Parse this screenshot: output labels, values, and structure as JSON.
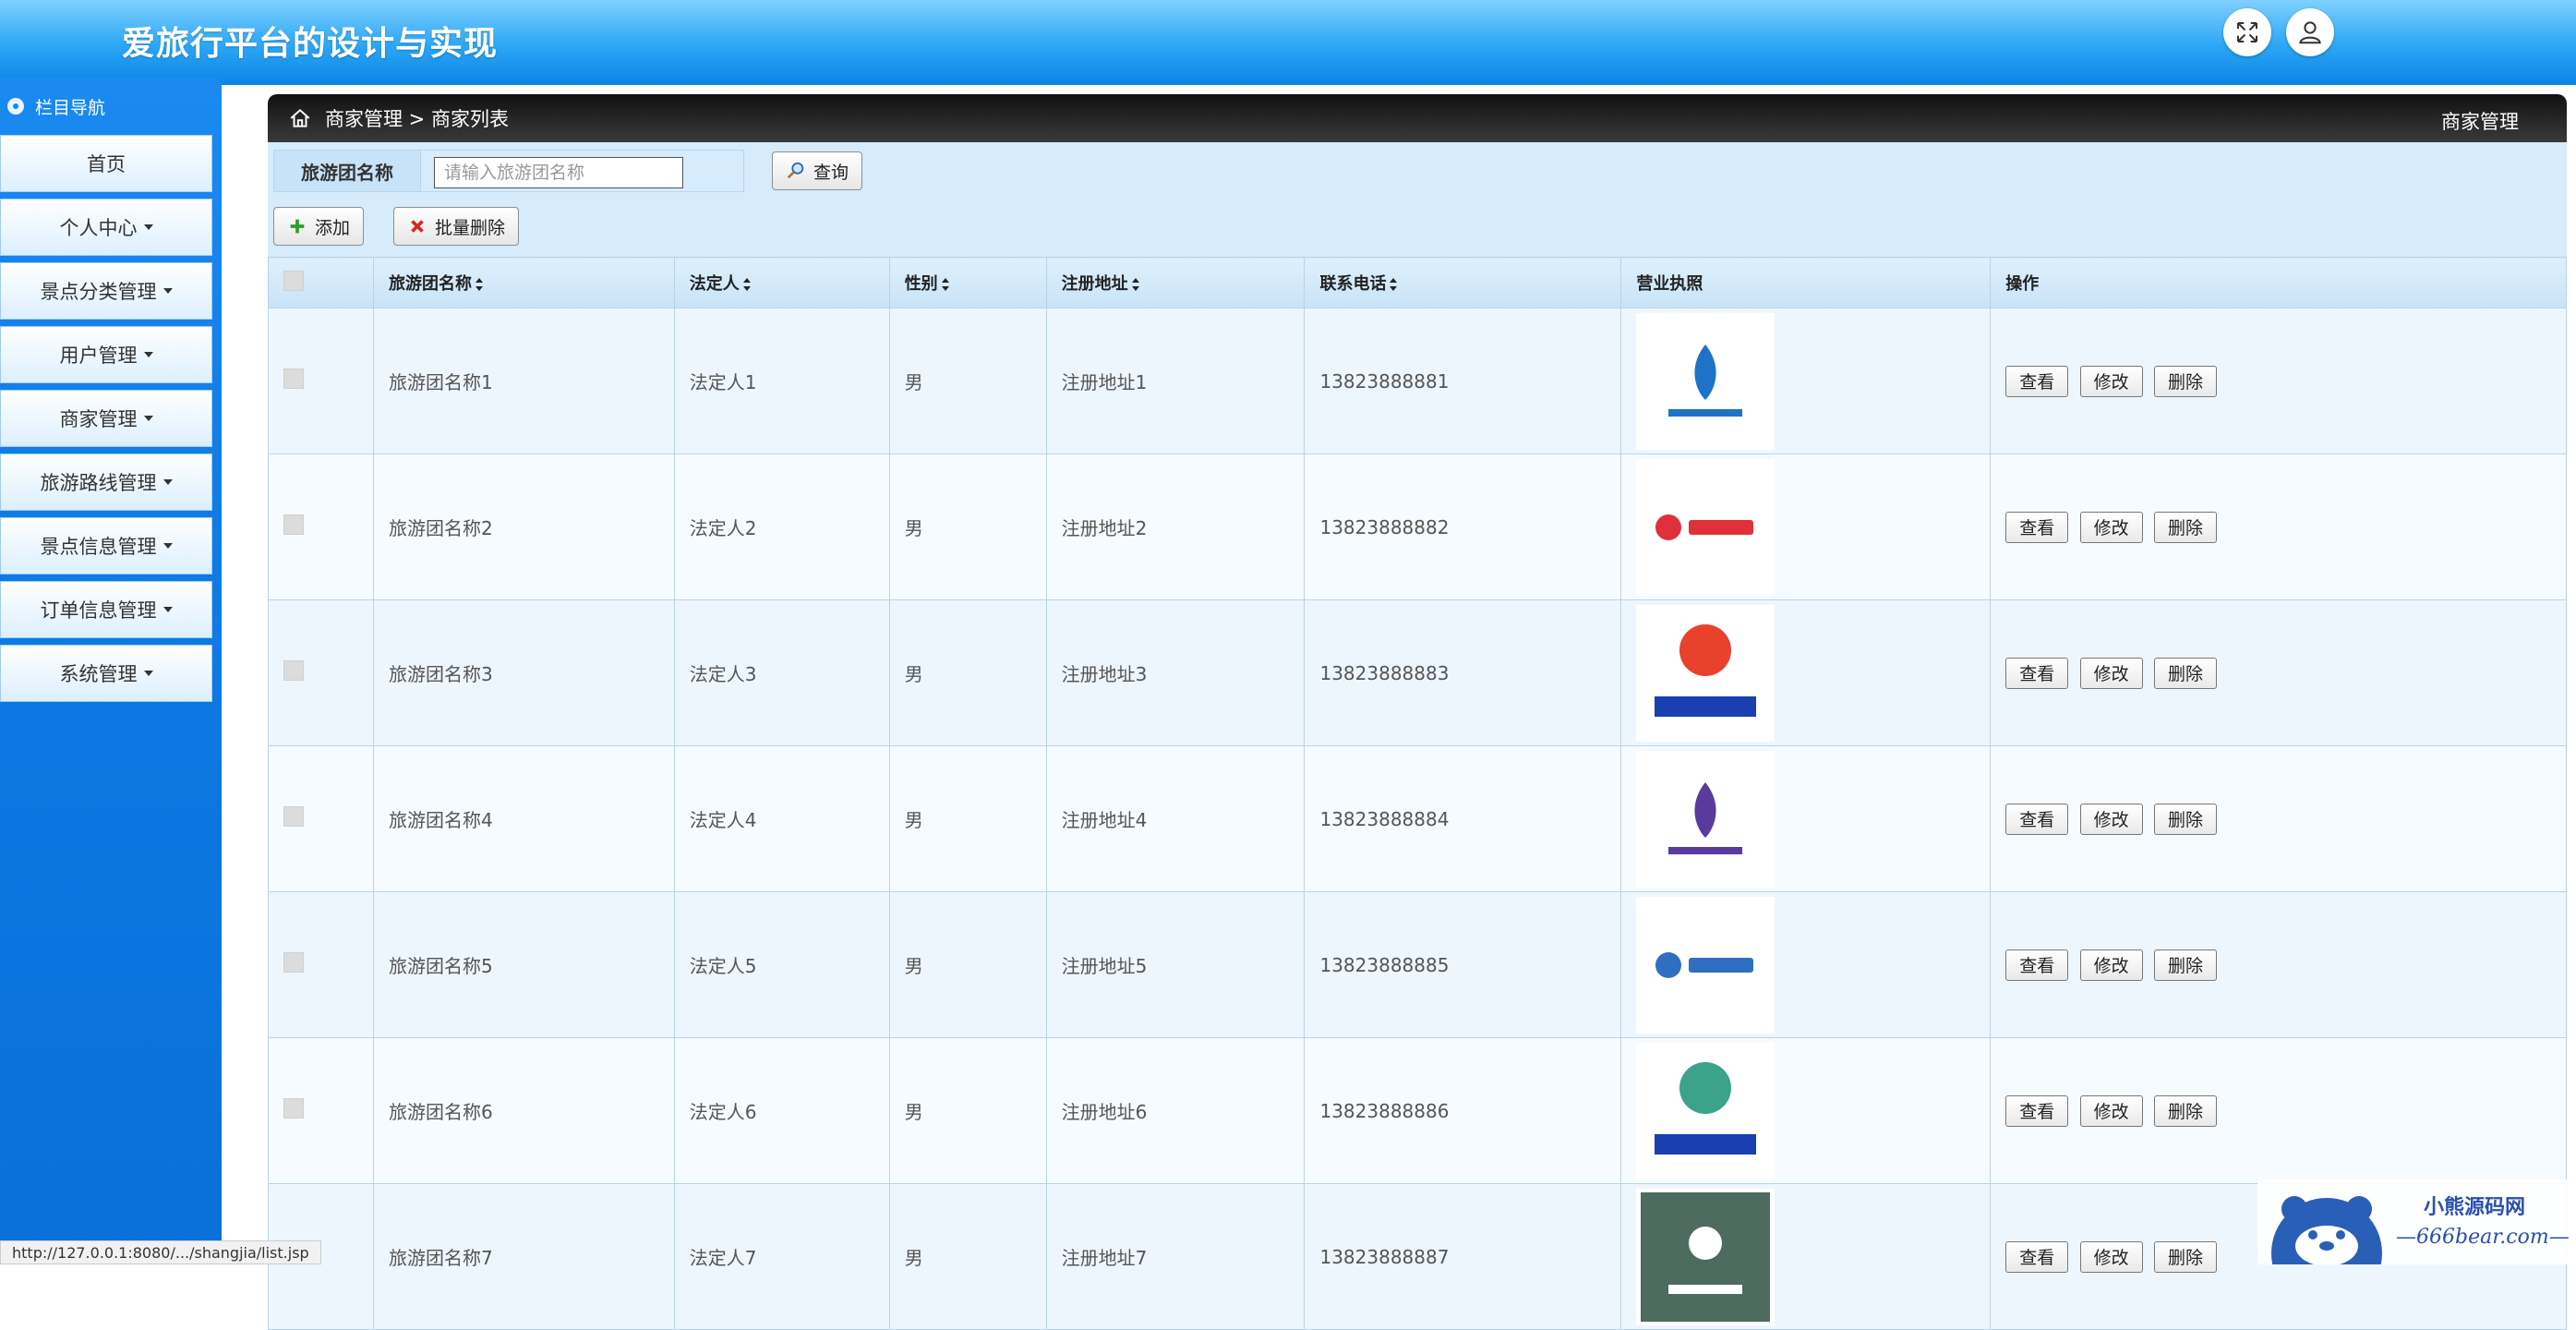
{
  "app": {
    "title": "爱旅行平台的设计与实现"
  },
  "header": {
    "fullscreen_icon": "expand-icon",
    "user_icon": "user-icon"
  },
  "sidebar": {
    "heading": "栏目导航",
    "items": [
      {
        "label": "首页",
        "has_caret": false
      },
      {
        "label": "个人中心",
        "has_caret": true
      },
      {
        "label": "景点分类管理",
        "has_caret": true
      },
      {
        "label": "用户管理",
        "has_caret": true
      },
      {
        "label": "商家管理",
        "has_caret": true
      },
      {
        "label": "旅游路线管理",
        "has_caret": true
      },
      {
        "label": "景点信息管理",
        "has_caret": true
      },
      {
        "label": "订单信息管理",
        "has_caret": true
      },
      {
        "label": "系统管理",
        "has_caret": true
      }
    ]
  },
  "breadcrumb": {
    "path": "商家管理 > 商家列表",
    "right": "商家管理"
  },
  "search": {
    "label": "旅游团名称",
    "placeholder": "请输入旅游团名称",
    "value": "",
    "button": "查询"
  },
  "toolbar": {
    "add": "添加",
    "batch_delete": "批量删除"
  },
  "table": {
    "headers": [
      "旅游团名称",
      "法定人",
      "性别",
      "注册地址",
      "联系电话",
      "营业执照",
      "操作"
    ],
    "actions": {
      "view": "查看",
      "edit": "修改",
      "delete": "删除"
    },
    "rows": [
      {
        "name": "旅游团名称1",
        "legal": "法定人1",
        "gender": "男",
        "addr": "注册地址1",
        "phone": "13823888881"
      },
      {
        "name": "旅游团名称2",
        "legal": "法定人2",
        "gender": "男",
        "addr": "注册地址2",
        "phone": "13823888882"
      },
      {
        "name": "旅游团名称3",
        "legal": "法定人3",
        "gender": "男",
        "addr": "注册地址3",
        "phone": "13823888883"
      },
      {
        "name": "旅游团名称4",
        "legal": "法定人4",
        "gender": "男",
        "addr": "注册地址4",
        "phone": "13823888884"
      },
      {
        "name": "旅游团名称5",
        "legal": "法定人5",
        "gender": "男",
        "addr": "注册地址5",
        "phone": "13823888885"
      },
      {
        "name": "旅游团名称6",
        "legal": "法定人6",
        "gender": "男",
        "addr": "注册地址6",
        "phone": "13823888886"
      },
      {
        "name": "旅游团名称7",
        "legal": "法定人7",
        "gender": "男",
        "addr": "注册地址7",
        "phone": "13823888887"
      }
    ]
  },
  "statusbar": {
    "url": "http://127.0.0.1:8080/.../shangjia/list.jsp"
  },
  "watermark": {
    "line1": "小熊源码网",
    "line2": "—666bear.com—"
  },
  "colors": {
    "header": "#2aa6f5",
    "sidebar": "#0e7be4",
    "crumbbar": "#222222",
    "toolarea": "#d6ebfb"
  }
}
